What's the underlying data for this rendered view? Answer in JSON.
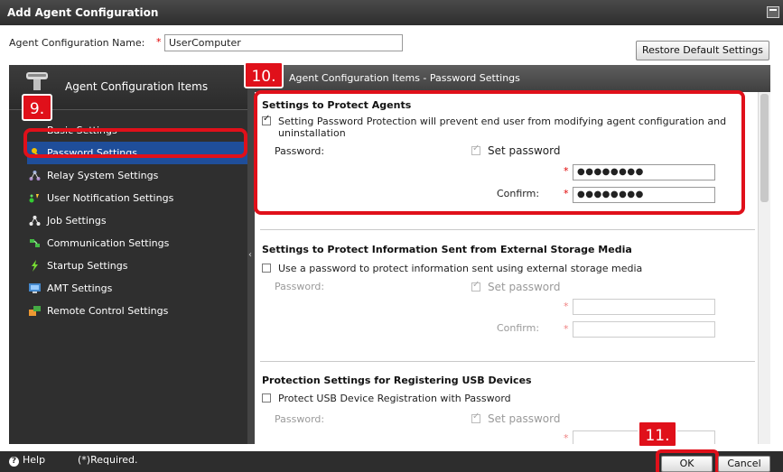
{
  "window": {
    "title": "Add Agent Configuration"
  },
  "name_row": {
    "label": "Agent Configuration Name:",
    "required_mark": "*",
    "value": "UserComputer",
    "restore_button": "Restore Default Settings"
  },
  "sidebar": {
    "header": "Agent Configuration Items",
    "items": [
      {
        "label": "Basic Settings",
        "icon": "settings-icon",
        "active": false
      },
      {
        "label": "Password Settings",
        "icon": "key-icon",
        "active": true
      },
      {
        "label": "Relay System Settings",
        "icon": "relay-icon",
        "active": false
      },
      {
        "label": "User Notification Settings",
        "icon": "notification-icon",
        "active": false
      },
      {
        "label": "Job Settings",
        "icon": "job-icon",
        "active": false
      },
      {
        "label": "Communication Settings",
        "icon": "communication-icon",
        "active": false
      },
      {
        "label": "Startup Settings",
        "icon": "startup-icon",
        "active": false
      },
      {
        "label": "AMT Settings",
        "icon": "amt-icon",
        "active": false
      },
      {
        "label": "Remote Control Settings",
        "icon": "remote-control-icon",
        "active": false
      }
    ]
  },
  "content": {
    "header": "Agent Configuration Items - Password Settings",
    "section1": {
      "title": "Settings to Protect Agents",
      "checkbox_label_line1": "Setting Password Protection will prevent end user from modifying agent configuration and",
      "checkbox_label_line2": "uninstallation",
      "checkbox_checked": true,
      "password_label": "Password:",
      "set_password_label": "Set password",
      "password_value": "●●●●●●●●",
      "confirm_label": "Confirm:",
      "confirm_value": "●●●●●●●●"
    },
    "section2": {
      "title": "Settings to Protect Information Sent from External Storage Media",
      "checkbox_label": "Use a password to protect information sent using external storage media",
      "password_label": "Password:",
      "set_password_label": "Set password",
      "confirm_label": "Confirm:"
    },
    "section3": {
      "title": "Protection Settings for Registering USB Devices",
      "checkbox_label": "Protect USB Device Registration with Password",
      "password_label": "Password:",
      "set_password_label": "Set password"
    }
  },
  "callouts": {
    "c9": "9.",
    "c10": "10.",
    "c11": "11."
  },
  "footer": {
    "help": "Help",
    "required_note": "(*)Required.",
    "ok": "OK",
    "cancel": "Cancel"
  },
  "colors": {
    "accent_red": "#e0101a",
    "active_item": "#1f4e9a",
    "sidebar_bg": "#2f2f2f"
  }
}
